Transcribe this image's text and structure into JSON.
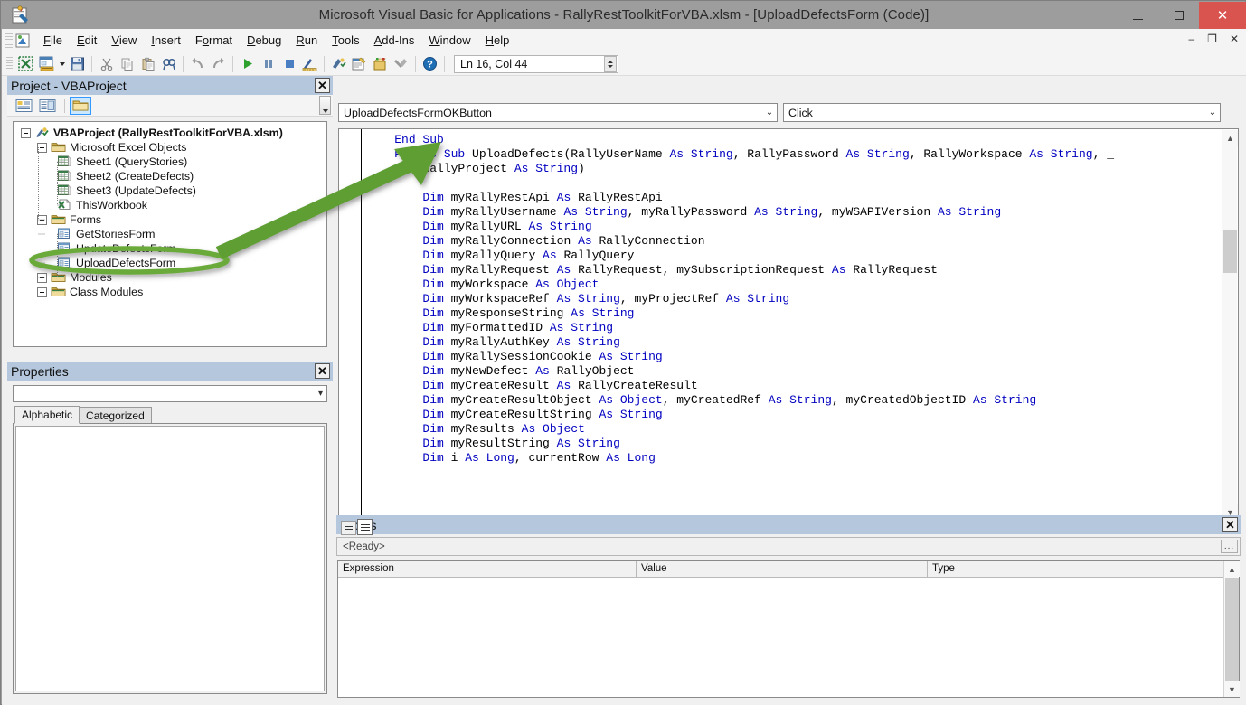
{
  "window": {
    "title": "Microsoft Visual Basic for Applications - RallyRestToolkitForVBA.xlsm - [UploadDefectsForm (Code)]",
    "app_icon": "vba-app-icon",
    "minimize_label": "–",
    "maximize_label": "□",
    "close_label": "✕"
  },
  "menubar": {
    "items": [
      {
        "label": "File",
        "accel": "F"
      },
      {
        "label": "Edit",
        "accel": "E"
      },
      {
        "label": "View",
        "accel": "V"
      },
      {
        "label": "Insert",
        "accel": "I"
      },
      {
        "label": "Format",
        "accel": "o"
      },
      {
        "label": "Debug",
        "accel": "D"
      },
      {
        "label": "Run",
        "accel": "R"
      },
      {
        "label": "Tools",
        "accel": "T"
      },
      {
        "label": "Add-Ins",
        "accel": "A"
      },
      {
        "label": "Window",
        "accel": "W"
      },
      {
        "label": "Help",
        "accel": "H"
      }
    ],
    "mdi_minimize": "–",
    "mdi_restore": "❐",
    "mdi_close": "✕"
  },
  "toolbar": {
    "buttons": [
      {
        "name": "view-excel-icon",
        "tip": "View Microsoft Excel"
      },
      {
        "name": "insert-userform-icon",
        "tip": "Insert UserForm"
      },
      {
        "name": "save-icon",
        "tip": "Save RallyRestToolkitForVBA.xlsm"
      },
      {
        "name": "cut-icon",
        "tip": "Cut"
      },
      {
        "name": "copy-icon",
        "tip": "Copy"
      },
      {
        "name": "paste-icon",
        "tip": "Paste"
      },
      {
        "name": "find-icon",
        "tip": "Find"
      },
      {
        "name": "undo-icon",
        "tip": "Undo"
      },
      {
        "name": "redo-icon",
        "tip": "Redo"
      },
      {
        "name": "run-icon",
        "tip": "Run Sub/UserForm"
      },
      {
        "name": "break-icon",
        "tip": "Break"
      },
      {
        "name": "reset-icon",
        "tip": "Reset"
      },
      {
        "name": "design-mode-icon",
        "tip": "Design Mode"
      },
      {
        "name": "project-explorer-icon",
        "tip": "Project Explorer"
      },
      {
        "name": "properties-window-icon",
        "tip": "Properties Window"
      },
      {
        "name": "object-browser-icon",
        "tip": "Object Browser"
      },
      {
        "name": "toolbox-icon",
        "tip": "Toolbox"
      },
      {
        "name": "help-icon",
        "tip": "Microsoft Visual Basic for Applications Help"
      }
    ],
    "position_indicator": "Ln 16, Col 44"
  },
  "project_explorer": {
    "title": "Project - VBAProject",
    "close_label": "✕",
    "toolbar": [
      {
        "name": "view-code-icon",
        "selected": false
      },
      {
        "name": "view-object-icon",
        "selected": false
      },
      {
        "name": "toggle-folders-icon",
        "selected": true
      }
    ],
    "tree": [
      {
        "level": 0,
        "label": "VBAProject (RallyRestToolkitForVBA.xlsm)",
        "icon": "vba-project-icon",
        "expander": "minus",
        "bold": true
      },
      {
        "level": 1,
        "label": "Microsoft Excel Objects",
        "icon": "folder-icon",
        "expander": "minus",
        "bold": false
      },
      {
        "level": 2,
        "label": "Sheet1 (QueryStories)",
        "icon": "worksheet-icon",
        "expander": "none",
        "bold": false
      },
      {
        "level": 2,
        "label": "Sheet2 (CreateDefects)",
        "icon": "worksheet-icon",
        "expander": "none",
        "bold": false
      },
      {
        "level": 2,
        "label": "Sheet3 (UpdateDefects)",
        "icon": "worksheet-icon",
        "expander": "none",
        "bold": false
      },
      {
        "level": 2,
        "label": "ThisWorkbook",
        "icon": "workbook-icon",
        "expander": "none",
        "bold": false
      },
      {
        "level": 1,
        "label": "Forms",
        "icon": "folder-icon",
        "expander": "minus",
        "bold": false
      },
      {
        "level": 2,
        "label": "GetStoriesForm",
        "icon": "userform-icon",
        "expander": "none",
        "bold": false
      },
      {
        "level": 2,
        "label": "UpdateDefectsForm",
        "icon": "userform-icon",
        "expander": "none",
        "bold": false
      },
      {
        "level": 2,
        "label": "UploadDefectsForm",
        "icon": "userform-icon",
        "expander": "none",
        "bold": false,
        "highlighted": true
      },
      {
        "level": 1,
        "label": "Modules",
        "icon": "folder-icon",
        "expander": "plus",
        "bold": false
      },
      {
        "level": 1,
        "label": "Class Modules",
        "icon": "folder-icon",
        "expander": "plus",
        "bold": false
      }
    ]
  },
  "properties_panel": {
    "title": "Properties",
    "close_label": "✕",
    "object_value": "",
    "tabs": [
      {
        "label": "Alphabetic",
        "active": true
      },
      {
        "label": "Categorized",
        "active": false
      }
    ]
  },
  "code_window": {
    "object_dropdown": "UploadDefectsFormOKButton",
    "procedure_dropdown": "Click",
    "dropdown_arrow": "⌄",
    "view_buttons": [
      {
        "name": "procedure-view-button",
        "active": false
      },
      {
        "name": "full-module-view-button",
        "active": true
      }
    ],
    "lines": [
      [
        {
          "t": "    ",
          "k": false
        },
        {
          "t": "End Sub",
          "k": true
        }
      ],
      [
        {
          "t": "    ",
          "k": false
        },
        {
          "t": "Public Sub ",
          "k": true
        },
        {
          "t": "UploadDefects(RallyUserName ",
          "k": false
        },
        {
          "t": "As String",
          "k": true
        },
        {
          "t": ", RallyPassword ",
          "k": false
        },
        {
          "t": "As String",
          "k": true
        },
        {
          "t": ", RallyWorkspace ",
          "k": false
        },
        {
          "t": "As String",
          "k": true
        },
        {
          "t": ", _",
          "k": false
        }
      ],
      [
        {
          "t": "        RallyProject ",
          "k": false
        },
        {
          "t": "As String",
          "k": true
        },
        {
          "t": ")",
          "k": false
        }
      ],
      [
        {
          "t": "",
          "k": false
        }
      ],
      [
        {
          "t": "        ",
          "k": false
        },
        {
          "t": "Dim",
          "k": true
        },
        {
          "t": " myRallyRestApi ",
          "k": false
        },
        {
          "t": "As",
          "k": true
        },
        {
          "t": " RallyRestApi",
          "k": false
        }
      ],
      [
        {
          "t": "        ",
          "k": false
        },
        {
          "t": "Dim",
          "k": true
        },
        {
          "t": " myRallyUsername ",
          "k": false
        },
        {
          "t": "As String",
          "k": true
        },
        {
          "t": ", myRallyPassword ",
          "k": false
        },
        {
          "t": "As String",
          "k": true
        },
        {
          "t": ", myWSAPIVersion ",
          "k": false
        },
        {
          "t": "As String",
          "k": true
        }
      ],
      [
        {
          "t": "        ",
          "k": false
        },
        {
          "t": "Dim",
          "k": true
        },
        {
          "t": " myRallyURL ",
          "k": false
        },
        {
          "t": "As String",
          "k": true
        }
      ],
      [
        {
          "t": "        ",
          "k": false
        },
        {
          "t": "Dim",
          "k": true
        },
        {
          "t": " myRallyConnection ",
          "k": false
        },
        {
          "t": "As",
          "k": true
        },
        {
          "t": " RallyConnection",
          "k": false
        }
      ],
      [
        {
          "t": "        ",
          "k": false
        },
        {
          "t": "Dim",
          "k": true
        },
        {
          "t": " myRallyQuery ",
          "k": false
        },
        {
          "t": "As",
          "k": true
        },
        {
          "t": " RallyQuery",
          "k": false
        }
      ],
      [
        {
          "t": "        ",
          "k": false
        },
        {
          "t": "Dim",
          "k": true
        },
        {
          "t": " myRallyRequest ",
          "k": false
        },
        {
          "t": "As",
          "k": true
        },
        {
          "t": " RallyRequest, mySubscriptionRequest ",
          "k": false
        },
        {
          "t": "As",
          "k": true
        },
        {
          "t": " RallyRequest",
          "k": false
        }
      ],
      [
        {
          "t": "        ",
          "k": false
        },
        {
          "t": "Dim",
          "k": true
        },
        {
          "t": " myWorkspace ",
          "k": false
        },
        {
          "t": "As Object",
          "k": true
        }
      ],
      [
        {
          "t": "        ",
          "k": false
        },
        {
          "t": "Dim",
          "k": true
        },
        {
          "t": " myWorkspaceRef ",
          "k": false
        },
        {
          "t": "As String",
          "k": true
        },
        {
          "t": ", myProjectRef ",
          "k": false
        },
        {
          "t": "As String",
          "k": true
        }
      ],
      [
        {
          "t": "        ",
          "k": false
        },
        {
          "t": "Dim",
          "k": true
        },
        {
          "t": " myResponseString ",
          "k": false
        },
        {
          "t": "As String",
          "k": true
        }
      ],
      [
        {
          "t": "        ",
          "k": false
        },
        {
          "t": "Dim",
          "k": true
        },
        {
          "t": " myFormattedID ",
          "k": false
        },
        {
          "t": "As String",
          "k": true
        }
      ],
      [
        {
          "t": "        ",
          "k": false
        },
        {
          "t": "Dim",
          "k": true
        },
        {
          "t": " myRallyAuthKey ",
          "k": false
        },
        {
          "t": "As String",
          "k": true
        }
      ],
      [
        {
          "t": "        ",
          "k": false
        },
        {
          "t": "Dim",
          "k": true
        },
        {
          "t": " myRallySessionCookie ",
          "k": false
        },
        {
          "t": "As String",
          "k": true
        }
      ],
      [
        {
          "t": "        ",
          "k": false
        },
        {
          "t": "Dim",
          "k": true
        },
        {
          "t": " myNewDefect ",
          "k": false
        },
        {
          "t": "As",
          "k": true
        },
        {
          "t": " RallyObject",
          "k": false
        }
      ],
      [
        {
          "t": "        ",
          "k": false
        },
        {
          "t": "Dim",
          "k": true
        },
        {
          "t": " myCreateResult ",
          "k": false
        },
        {
          "t": "As",
          "k": true
        },
        {
          "t": " RallyCreateResult",
          "k": false
        }
      ],
      [
        {
          "t": "        ",
          "k": false
        },
        {
          "t": "Dim",
          "k": true
        },
        {
          "t": " myCreateResultObject ",
          "k": false
        },
        {
          "t": "As Object",
          "k": true
        },
        {
          "t": ", myCreatedRef ",
          "k": false
        },
        {
          "t": "As String",
          "k": true
        },
        {
          "t": ", myCreatedObjectID ",
          "k": false
        },
        {
          "t": "As String",
          "k": true
        }
      ],
      [
        {
          "t": "        ",
          "k": false
        },
        {
          "t": "Dim",
          "k": true
        },
        {
          "t": " myCreateResultString ",
          "k": false
        },
        {
          "t": "As String",
          "k": true
        }
      ],
      [
        {
          "t": "        ",
          "k": false
        },
        {
          "t": "Dim",
          "k": true
        },
        {
          "t": " myResults ",
          "k": false
        },
        {
          "t": "As Object",
          "k": true
        }
      ],
      [
        {
          "t": "        ",
          "k": false
        },
        {
          "t": "Dim",
          "k": true
        },
        {
          "t": " myResultString ",
          "k": false
        },
        {
          "t": "As String",
          "k": true
        }
      ],
      [
        {
          "t": "        ",
          "k": false
        },
        {
          "t": "Dim",
          "k": true
        },
        {
          "t": " i ",
          "k": false
        },
        {
          "t": "As Long",
          "k": true
        },
        {
          "t": ", currentRow ",
          "k": false
        },
        {
          "t": "As Long",
          "k": true
        }
      ]
    ]
  },
  "locals_window": {
    "title": "Locals",
    "close_label": "✕",
    "status": "<Ready>",
    "more_button": "...",
    "columns": [
      "Expression",
      "Value",
      "Type"
    ],
    "rows": []
  },
  "annotation": {
    "type": "arrow-and-ellipse",
    "color": "#5f9e33",
    "ellipse_target": "UploadDefectsForm",
    "arrow_target": "Sub keyword in UploadDefects declaration"
  }
}
